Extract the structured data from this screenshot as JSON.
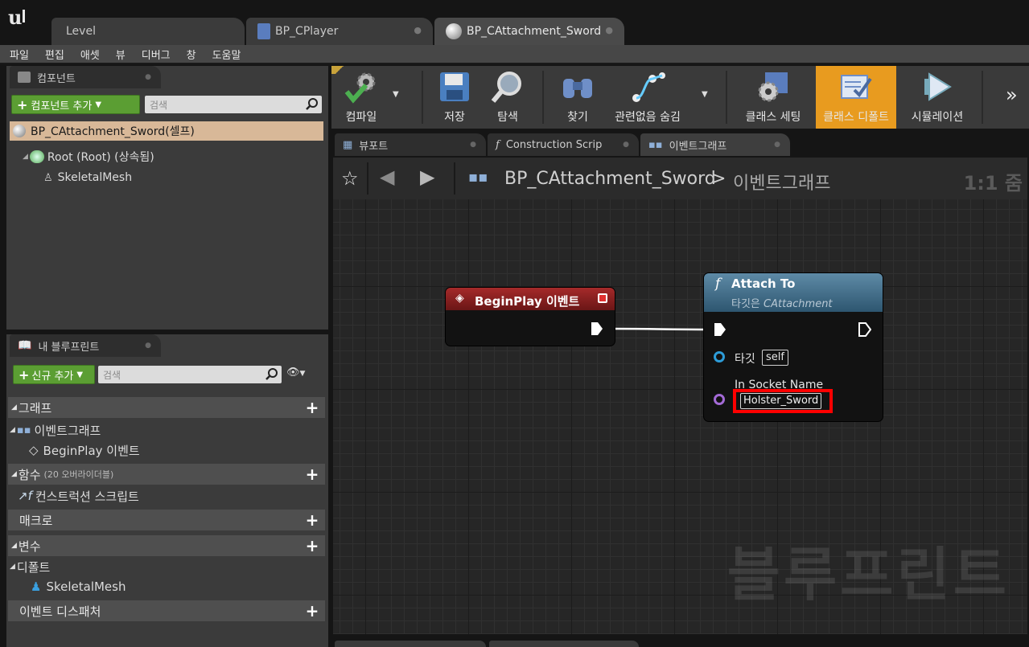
{
  "tabs": [
    {
      "label": "Level"
    },
    {
      "label": "BP_CPlayer"
    },
    {
      "label": "BP_CAttachment_Sword"
    }
  ],
  "menu": [
    "파일",
    "편집",
    "애셋",
    "뷰",
    "디버그",
    "창",
    "도움말"
  ],
  "components_panel": {
    "tab_label": "컴포넌트",
    "add_button": "컴포넌트 추가",
    "search_placeholder": "검색",
    "self_item": "BP_CAttachment_Sword(셀프)",
    "root_item": "Root (Root) (상속됨)",
    "child_item": "SkeletalMesh"
  },
  "my_blueprint_panel": {
    "tab_label": "내 블루프린트",
    "new_button": "신규 추가",
    "search_placeholder": "검색",
    "graph_section": "그래프",
    "event_graph_item": "이벤트그래프",
    "beginplay_item": "BeginPlay 이벤트",
    "functions_section": "함수",
    "functions_count": "(20 오버라이더블)",
    "construction_item": "컨스트럭션 스크립트",
    "macros_section": "매크로",
    "variables_section": "변수",
    "default_category": "디폴트",
    "skeletal_var": "SkeletalMesh",
    "dispatchers_section": "이벤트 디스패처"
  },
  "toolbar": {
    "compile": "컴파일",
    "save": "저장",
    "browse": "탐색",
    "find": "찾기",
    "hide_unrelated": "관련없음 숨김",
    "class_settings": "클래스 세팅",
    "class_defaults": "클래스 디폴트",
    "simulation": "시뮬레이션"
  },
  "editor_tabs": {
    "viewport": "뷰포트",
    "construction": "Construction Scrip",
    "event_graph": "이벤트그래프"
  },
  "breadcrumb": {
    "blueprint": "BP_CAttachment_Sword",
    "separator": ">",
    "graph": "이벤트그래프",
    "zoom": "1:1 줌"
  },
  "nodes": {
    "beginplay_title": "BeginPlay 이벤트",
    "attach_title": "Attach To",
    "attach_subtitle_prefix": "타깃은 ",
    "attach_subtitle_class": "CAttachment",
    "target_label": "타깃",
    "target_value": "self",
    "socket_label": "In Socket Name",
    "socket_value": "Holster_Sword"
  },
  "watermark": "블루프린트",
  "colors": {
    "accent_orange": "#e89b1f",
    "add_green": "#5b9e33",
    "event_node_red": "#8a1e1e",
    "function_node_blue": "#3c6f8c",
    "highlight_red": "#ff0000"
  }
}
